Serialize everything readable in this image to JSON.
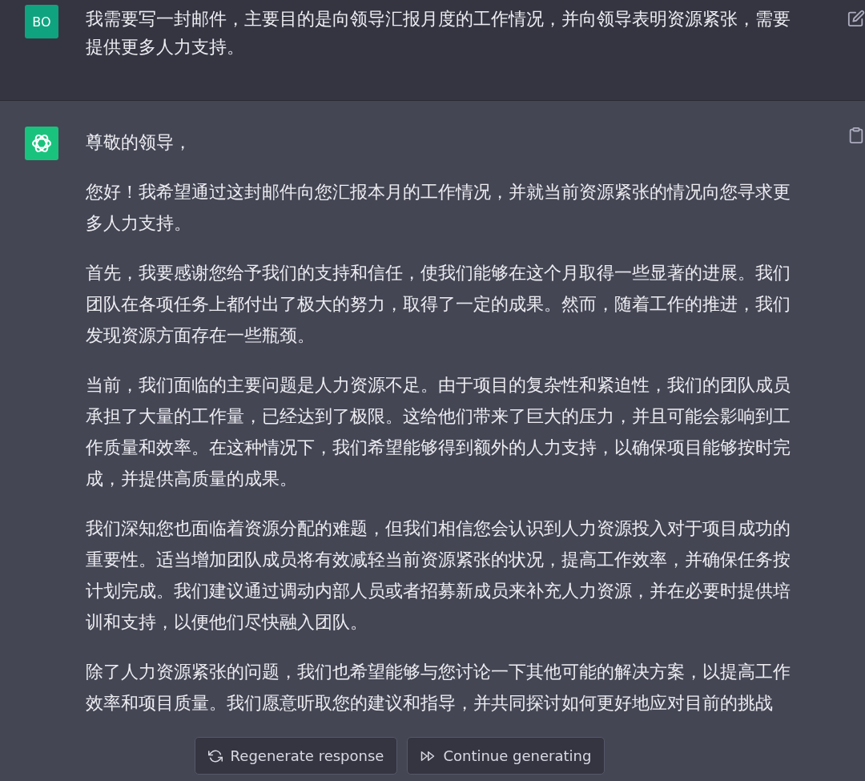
{
  "user_message": {
    "avatar": "BO",
    "text": "我需要写一封邮件，主要目的是向领导汇报月度的工作情况，并向领导表明资源紧张，需要提供更多人力支持。"
  },
  "assistant_message": {
    "paragraphs": [
      "尊敬的领导，",
      "您好！我希望通过这封邮件向您汇报本月的工作情况，并就当前资源紧张的情况向您寻求更多人力支持。",
      "首先，我要感谢您给予我们的支持和信任，使我们能够在这个月取得一些显著的进展。我们团队在各项任务上都付出了极大的努力，取得了一定的成果。然而，随着工作的推进，我们发现资源方面存在一些瓶颈。",
      "当前，我们面临的主要问题是人力资源不足。由于项目的复杂性和紧迫性，我们的团队成员承担了大量的工作量，已经达到了极限。这给他们带来了巨大的压力，并且可能会影响到工作质量和效率。在这种情况下，我们希望能够得到额外的人力支持，以确保项目能够按时完成，并提供高质量的成果。",
      "我们深知您也面临着资源分配的难题，但我们相信您会认识到人力资源投入对于项目成功的重要性。适当增加团队成员将有效减轻当前资源紧张的状况，提高工作效率，并确保任务按计划完成。我们建议通过调动内部人员或者招募新成员来补充人力资源，并在必要时提供培训和支持，以便他们尽快融入团队。",
      "除了人力资源紧张的问题，我们也希望能够与您讨论一下其他可能的解决方案，以提高工作效率和项目质量。我们愿意听取您的建议和指导，并共同探讨如何更好地应对目前的挑战"
    ]
  },
  "buttons": [
    {
      "kind": "regenerate",
      "label": "Regenerate response"
    },
    {
      "kind": "continue",
      "label": "Continue generating"
    }
  ]
}
